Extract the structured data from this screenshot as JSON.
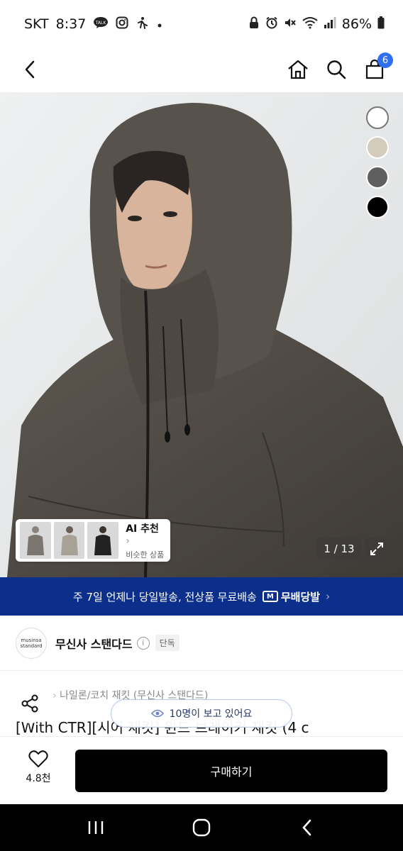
{
  "status_bar": {
    "carrier": "SKT",
    "time": "8:37",
    "battery": "86%",
    "left_icons": [
      "talk-icon",
      "instagram-icon",
      "activity-icon",
      "dot-icon"
    ],
    "right_icons": [
      "lock-icon",
      "alarm-icon",
      "mute-icon",
      "wifi-icon",
      "signal-icon",
      "battery-icon"
    ]
  },
  "nav": {
    "cart_count": "6",
    "icons": [
      "back-icon",
      "home-icon",
      "search-icon",
      "cart-icon"
    ]
  },
  "gallery": {
    "counter": "1 / 13",
    "swatches": [
      "#ffffff",
      "#d3cbbb",
      "#5f5f5f",
      "#000000"
    ],
    "ai_title": "AI 추천",
    "ai_sub": "비슷한 상품",
    "ai_chevron": "›"
  },
  "banner": {
    "text": "주 7일 언제나 당일발송, 전상품 무료배송",
    "logo_mark": "M",
    "logo_text": "무배당발",
    "chevron": "›"
  },
  "brand": {
    "logo_line1": "musinsa",
    "logo_line2": "standard",
    "name": "무신사 스탠다드",
    "info": "i",
    "badge": "단독"
  },
  "product": {
    "category": "나일론/코치 재킷 (무신사 스탠다드)",
    "title": "[With CTR][시어 재킷] 윈드 브레이커 재킷 (4 c"
  },
  "overlay": {
    "viewers": "10명이 보고 있어요"
  },
  "bottom": {
    "like_count": "4.8천",
    "buy_label": "구매하기"
  },
  "colors": {
    "banner_bg": "#0b2f8a",
    "badge_blue": "#2f6ff0",
    "buy_bg": "#000000"
  }
}
